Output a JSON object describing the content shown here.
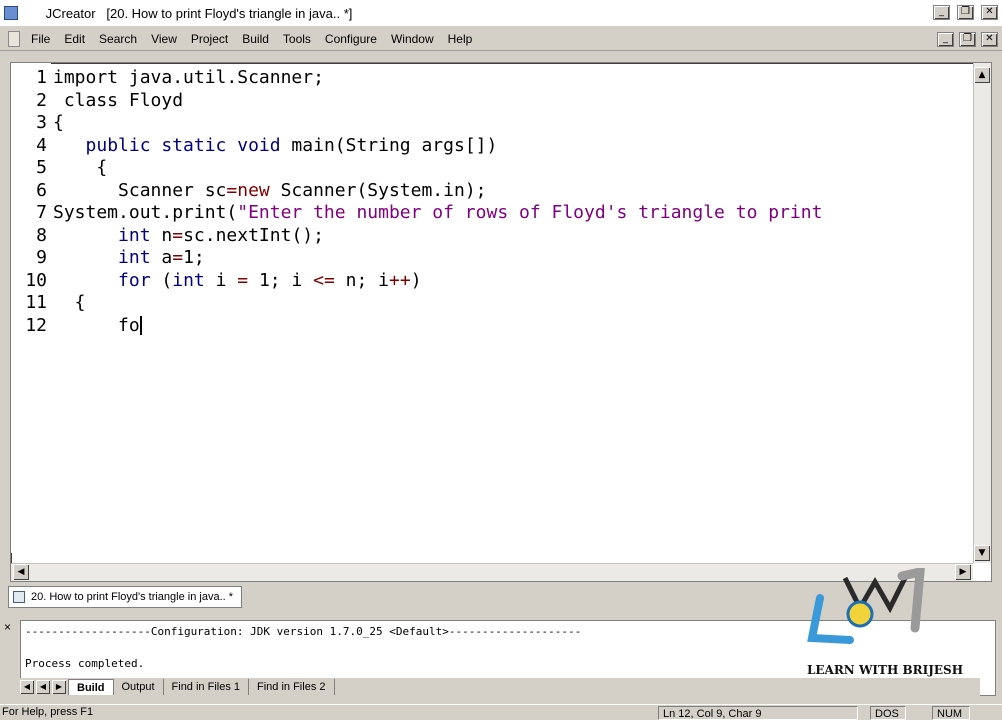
{
  "window": {
    "app_name": "JCreator",
    "title_suffix": "[20. How to print Floyd's triangle in java.. *]",
    "minimize": "_",
    "restore": "❐",
    "close": "✕"
  },
  "menu": [
    "File",
    "Edit",
    "Search",
    "View",
    "Project",
    "Build",
    "Tools",
    "Configure",
    "Window",
    "Help"
  ],
  "editor": {
    "line_numbers": [
      "1",
      "2",
      "3",
      "4",
      "5",
      "6",
      "7",
      "8",
      "9",
      "10",
      "11",
      "12"
    ],
    "lines": [
      [
        {
          "t": "import java.util.Scanner;",
          "c": "plain"
        }
      ],
      [
        {
          "t": " class Floyd",
          "c": "plain"
        }
      ],
      [
        {
          "t": "{",
          "c": "plain"
        }
      ],
      [
        {
          "t": "   ",
          "c": "plain"
        },
        {
          "t": "public static void",
          "c": "kw"
        },
        {
          "t": " main(String args[])",
          "c": "plain"
        }
      ],
      [
        {
          "t": "    {",
          "c": "plain"
        }
      ],
      [
        {
          "t": "      Scanner sc",
          "c": "plain"
        },
        {
          "t": "=new",
          "c": "op"
        },
        {
          "t": " Scanner(System.in);",
          "c": "plain"
        }
      ],
      [
        {
          "t": "System.out.print(",
          "c": "plain"
        },
        {
          "t": "\"Enter the number of rows of Floyd's triangle to print",
          "c": "str"
        }
      ],
      [
        {
          "t": "      ",
          "c": "plain"
        },
        {
          "t": "int",
          "c": "kw"
        },
        {
          "t": " n",
          "c": "plain"
        },
        {
          "t": "=",
          "c": "op"
        },
        {
          "t": "sc.nextInt();",
          "c": "plain"
        }
      ],
      [
        {
          "t": "      ",
          "c": "plain"
        },
        {
          "t": "int",
          "c": "kw"
        },
        {
          "t": " a",
          "c": "plain"
        },
        {
          "t": "=",
          "c": "op"
        },
        {
          "t": "1;",
          "c": "plain"
        }
      ],
      [
        {
          "t": "      ",
          "c": "plain"
        },
        {
          "t": "for",
          "c": "kw"
        },
        {
          "t": " (",
          "c": "plain"
        },
        {
          "t": "int",
          "c": "kw"
        },
        {
          "t": " i ",
          "c": "plain"
        },
        {
          "t": "=",
          "c": "op"
        },
        {
          "t": " 1; i ",
          "c": "plain"
        },
        {
          "t": "<=",
          "c": "op"
        },
        {
          "t": " n; i",
          "c": "plain"
        },
        {
          "t": "++",
          "c": "op"
        },
        {
          "t": ")",
          "c": "plain"
        }
      ],
      [
        {
          "t": "  {",
          "c": "plain"
        }
      ],
      [
        {
          "t": "      fo",
          "c": "plain"
        }
      ]
    ]
  },
  "doc_tab": "20. How to print Floyd's triangle in java.. *",
  "output": {
    "config_line": "-------------------Configuration: JDK version 1.7.0_25 <Default>--------------------",
    "process_line": "Process completed.",
    "tabs": [
      "Build",
      "Output",
      "Find in Files 1",
      "Find in Files 2"
    ],
    "active_tab": "Build"
  },
  "status": {
    "help": "For Help, press F1",
    "position": "Ln 12, Col 9, Char 9",
    "line_ending": "DOS",
    "num": "NUM"
  },
  "logo": {
    "text": "LEARN WITH BRIJESH",
    "mark": "LWB"
  }
}
